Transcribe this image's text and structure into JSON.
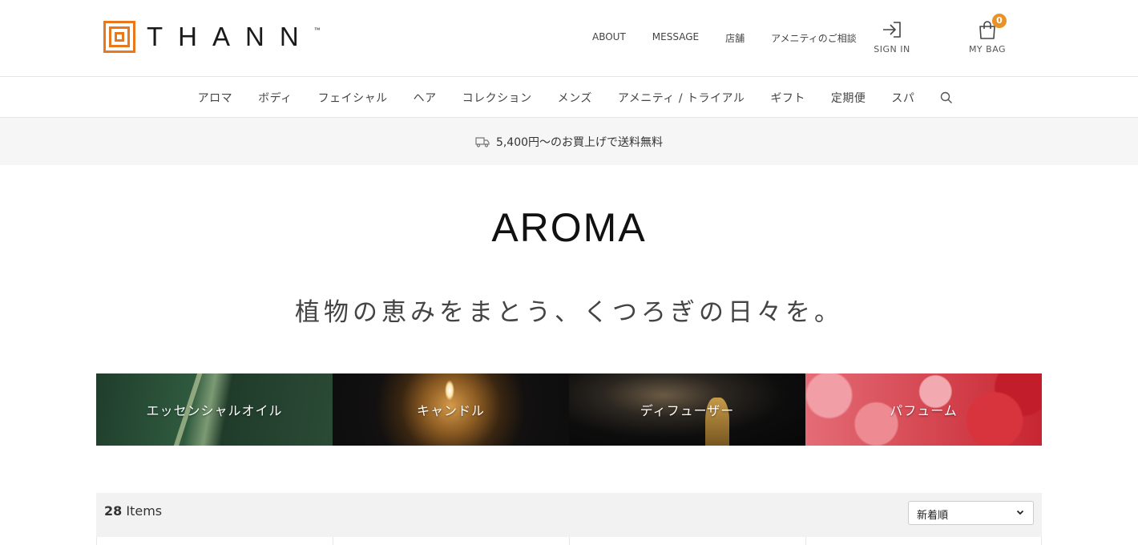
{
  "header": {
    "logo_text": "THANN",
    "logo_tm": "™",
    "top_links": [
      "ABOUT",
      "MESSAGE",
      "店舗",
      "アメニティのご相談"
    ],
    "signin_label": "SIGN IN",
    "bag_label": "MY BAG",
    "bag_count": "0"
  },
  "category_nav": [
    "アロマ",
    "ボディ",
    "フェイシャル",
    "ヘア",
    "コレクション",
    "メンズ",
    "アメニティ / トライアル",
    "ギフト",
    "定期便",
    "スパ"
  ],
  "shipping_banner": "5,400円～のお買上げで送料無料",
  "page": {
    "title": "AROMA",
    "tagline": "植物の恵みをまとう、くつろぎの日々を。"
  },
  "tiles": [
    "エッセンシャルオイル",
    "キャンドル",
    "ディフューザー",
    "パフューム"
  ],
  "listing": {
    "count": "28",
    "count_label": " Items",
    "sort_value": "新着順"
  },
  "colors": {
    "brand_orange": "#e8781e",
    "badge": "#e8922a"
  }
}
